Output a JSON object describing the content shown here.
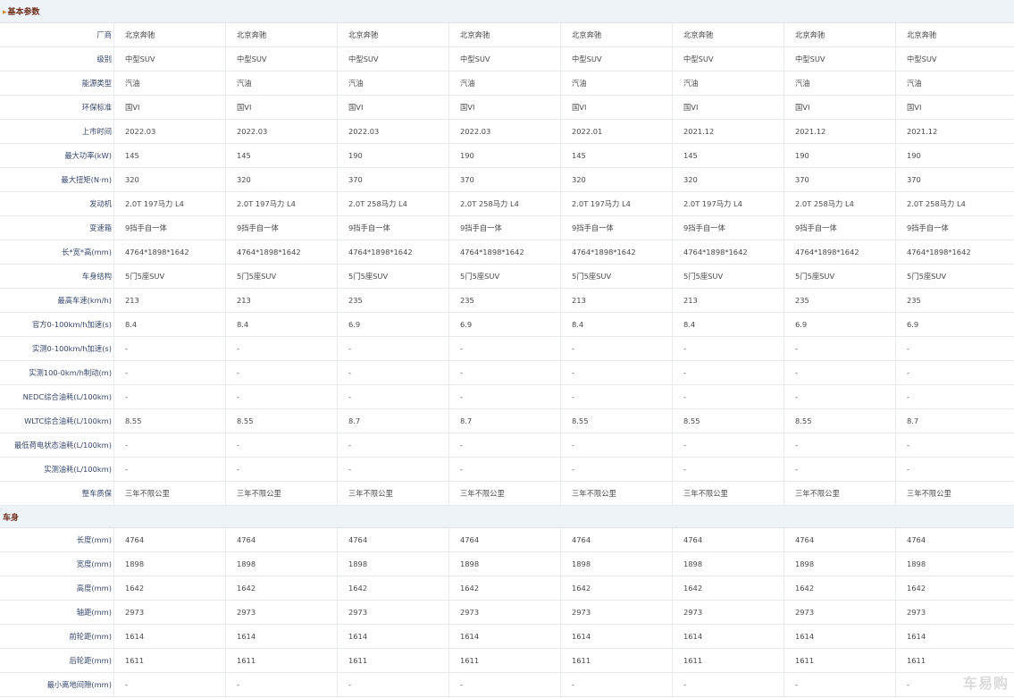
{
  "sections": [
    {
      "title": "基本参数",
      "bullet": "▸",
      "rows": [
        {
          "label": "厂商",
          "values": [
            "北京奔驰",
            "北京奔驰",
            "北京奔驰",
            "北京奔驰",
            "北京奔驰",
            "北京奔驰",
            "北京奔驰",
            "北京奔驰"
          ]
        },
        {
          "label": "级别",
          "values": [
            "中型SUV",
            "中型SUV",
            "中型SUV",
            "中型SUV",
            "中型SUV",
            "中型SUV",
            "中型SUV",
            "中型SUV"
          ]
        },
        {
          "label": "能源类型",
          "values": [
            "汽油",
            "汽油",
            "汽油",
            "汽油",
            "汽油",
            "汽油",
            "汽油",
            "汽油"
          ]
        },
        {
          "label": "环保标准",
          "values": [
            "国VI",
            "国VI",
            "国VI",
            "国VI",
            "国VI",
            "国VI",
            "国VI",
            "国VI"
          ]
        },
        {
          "label": "上市时间",
          "values": [
            "2022.03",
            "2022.03",
            "2022.03",
            "2022.03",
            "2022.01",
            "2021.12",
            "2021.12",
            "2021.12"
          ]
        },
        {
          "label": "最大功率(kW)",
          "values": [
            "145",
            "145",
            "190",
            "190",
            "145",
            "145",
            "190",
            "190"
          ]
        },
        {
          "label": "最大扭矩(N·m)",
          "values": [
            "320",
            "320",
            "370",
            "370",
            "320",
            "320",
            "370",
            "370"
          ]
        },
        {
          "label": "发动机",
          "values": [
            "2.0T 197马力 L4",
            "2.0T 197马力 L4",
            "2.0T 258马力 L4",
            "2.0T 258马力 L4",
            "2.0T 197马力 L4",
            "2.0T 197马力 L4",
            "2.0T 258马力 L4",
            "2.0T 258马力 L4"
          ]
        },
        {
          "label": "变速箱",
          "values": [
            "9挡手自一体",
            "9挡手自一体",
            "9挡手自一体",
            "9挡手自一体",
            "9挡手自一体",
            "9挡手自一体",
            "9挡手自一体",
            "9挡手自一体"
          ]
        },
        {
          "label": "长*宽*高(mm)",
          "values": [
            "4764*1898*1642",
            "4764*1898*1642",
            "4764*1898*1642",
            "4764*1898*1642",
            "4764*1898*1642",
            "4764*1898*1642",
            "4764*1898*1642",
            "4764*1898*1642"
          ]
        },
        {
          "label": "车身结构",
          "values": [
            "5门5座SUV",
            "5门5座SUV",
            "5门5座SUV",
            "5门5座SUV",
            "5门5座SUV",
            "5门5座SUV",
            "5门5座SUV",
            "5门5座SUV"
          ]
        },
        {
          "label": "最高车速(km/h)",
          "values": [
            "213",
            "213",
            "235",
            "235",
            "213",
            "213",
            "235",
            "235"
          ]
        },
        {
          "label": "官方0-100km/h加速(s)",
          "values": [
            "8.4",
            "8.4",
            "6.9",
            "6.9",
            "8.4",
            "8.4",
            "6.9",
            "6.9"
          ]
        },
        {
          "label": "实测0-100km/h加速(s)",
          "values": [
            "-",
            "-",
            "-",
            "-",
            "-",
            "-",
            "-",
            "-"
          ]
        },
        {
          "label": "实测100-0km/h制动(m)",
          "values": [
            "-",
            "-",
            "-",
            "-",
            "-",
            "-",
            "-",
            "-"
          ]
        },
        {
          "label": "NEDC综合油耗(L/100km)",
          "values": [
            "-",
            "-",
            "-",
            "-",
            "-",
            "-",
            "-",
            "-"
          ]
        },
        {
          "label": "WLTC综合油耗(L/100km)",
          "values": [
            "8.55",
            "8.55",
            "8.7",
            "8.7",
            "8.55",
            "8.55",
            "8.55",
            "8.7"
          ]
        },
        {
          "label": "最低荷电状态油耗(L/100km)",
          "values": [
            "-",
            "-",
            "-",
            "-",
            "-",
            "-",
            "-",
            "-"
          ]
        },
        {
          "label": "实测油耗(L/100km)",
          "values": [
            "-",
            "-",
            "-",
            "-",
            "-",
            "-",
            "-",
            "-"
          ]
        },
        {
          "label": "整车质保",
          "values": [
            "三年不限公里",
            "三年不限公里",
            "三年不限公里",
            "三年不限公里",
            "三年不限公里",
            "三年不限公里",
            "三年不限公里",
            "三年不限公里"
          ]
        }
      ]
    },
    {
      "title": "车身",
      "bullet": "",
      "rows": [
        {
          "label": "长度(mm)",
          "values": [
            "4764",
            "4764",
            "4764",
            "4764",
            "4764",
            "4764",
            "4764",
            "4764"
          ]
        },
        {
          "label": "宽度(mm)",
          "values": [
            "1898",
            "1898",
            "1898",
            "1898",
            "1898",
            "1898",
            "1898",
            "1898"
          ]
        },
        {
          "label": "高度(mm)",
          "values": [
            "1642",
            "1642",
            "1642",
            "1642",
            "1642",
            "1642",
            "1642",
            "1642"
          ]
        },
        {
          "label": "轴距(mm)",
          "values": [
            "2973",
            "2973",
            "2973",
            "2973",
            "2973",
            "2973",
            "2973",
            "2973"
          ]
        },
        {
          "label": "前轮距(mm)",
          "values": [
            "1614",
            "1614",
            "1614",
            "1614",
            "1614",
            "1614",
            "1614",
            "1614"
          ]
        },
        {
          "label": "后轮距(mm)",
          "values": [
            "1611",
            "1611",
            "1611",
            "1611",
            "1611",
            "1611",
            "1611",
            "1611"
          ]
        },
        {
          "label": "最小离地间隙(mm)",
          "values": [
            "-",
            "-",
            "-",
            "-",
            "-",
            "-",
            "-",
            "-"
          ]
        }
      ]
    }
  ],
  "watermark": "车易购",
  "colors": {
    "section_bg": "#eef3f8",
    "section_title": "#6e2f1c",
    "label_text": "#35466b",
    "value_text": "#4a4a4a",
    "grid_line": "#e7ebef"
  }
}
